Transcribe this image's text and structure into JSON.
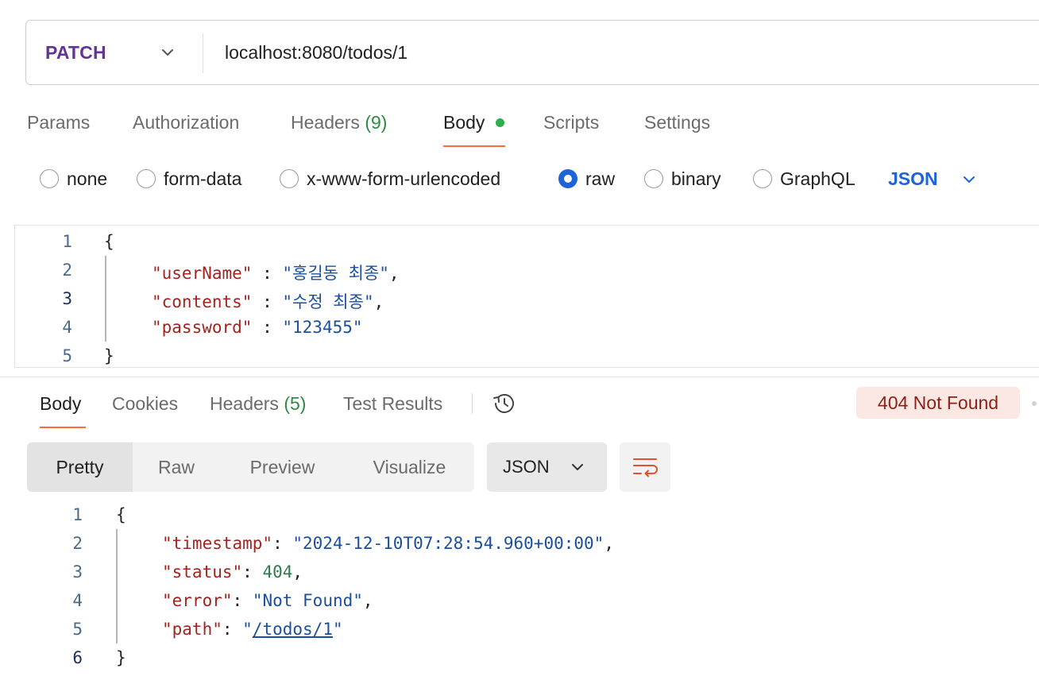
{
  "request": {
    "method": "PATCH",
    "url": "localhost:8080/todos/1"
  },
  "request_tabs": [
    {
      "label": "Params"
    },
    {
      "label": "Authorization"
    },
    {
      "label": "Headers",
      "count": "(9)"
    },
    {
      "label": "Body",
      "active": true
    },
    {
      "label": "Scripts"
    },
    {
      "label": "Settings"
    }
  ],
  "body_types": [
    {
      "label": "none"
    },
    {
      "label": "form-data"
    },
    {
      "label": "x-www-form-urlencoded"
    },
    {
      "label": "raw",
      "selected": true
    },
    {
      "label": "binary"
    },
    {
      "label": "GraphQL"
    }
  ],
  "body_format": "JSON",
  "request_body": {
    "line_numbers": [
      "1",
      "2",
      "3",
      "4",
      "5"
    ],
    "open": "{",
    "close": "}",
    "fields": [
      {
        "key": "\"userName\"",
        "sep": " : ",
        "value": "\"홍길동 최종\"",
        "trail": ","
      },
      {
        "key": "\"contents\"",
        "sep": " : ",
        "value": "\"수정 최종\"",
        "trail": ","
      },
      {
        "key": "\"password\"",
        "sep": " : ",
        "value": "\"123455\"",
        "trail": ""
      }
    ]
  },
  "response_tabs": [
    {
      "label": "Body",
      "active": true
    },
    {
      "label": "Cookies"
    },
    {
      "label": "Headers",
      "count": "(5)"
    },
    {
      "label": "Test Results"
    }
  ],
  "status": "404 Not Found",
  "view_modes": [
    "Pretty",
    "Raw",
    "Preview",
    "Visualize"
  ],
  "response_format": "JSON",
  "response_body": {
    "line_numbers": [
      "1",
      "2",
      "3",
      "4",
      "5",
      "6"
    ],
    "open": "{",
    "close": "}",
    "fields": [
      {
        "key": "\"timestamp\"",
        "sep": ": ",
        "value": "\"2024-12-10T07:28:54.960+00:00\"",
        "trail": ","
      },
      {
        "key": "\"status\"",
        "sep": ": ",
        "value": "404",
        "trail": ","
      },
      {
        "key": "\"error\"",
        "sep": ": ",
        "value": "\"Not Found\"",
        "trail": ","
      },
      {
        "key": "\"path\"",
        "sep": ": ",
        "value_quote_open": "\"",
        "value_link": "/todos/1",
        "value_quote_close": "\"",
        "trail": ""
      }
    ]
  },
  "colors": {
    "method": "#623497",
    "accent": "#ff6c37",
    "radio_selected": "#1d64d8",
    "status_bg": "#fbe8e3",
    "status_text": "#8e1f17",
    "json_key": "#a1241e",
    "json_string": "#1a4f9c",
    "json_number": "#2f7a4f"
  },
  "icons": {
    "method_dropdown": "chevron-down-icon",
    "format_dropdown": "chevron-down-icon",
    "history": "history-icon",
    "wrap": "wrap-lines-icon"
  }
}
